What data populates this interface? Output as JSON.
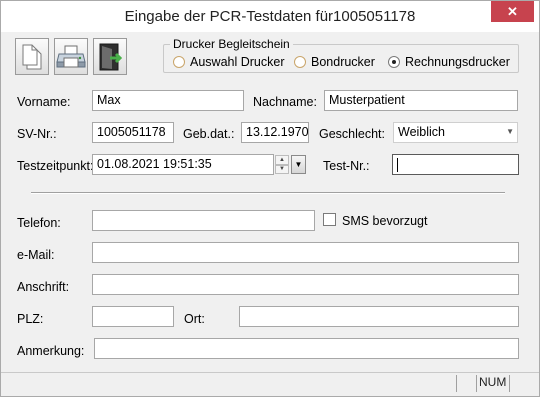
{
  "window": {
    "title": "Eingabe der PCR-Testdaten für1005051178",
    "close_glyph": "✕"
  },
  "toolbar": {
    "items": [
      {
        "icon": "new-document-icon"
      },
      {
        "icon": "printer-icon"
      },
      {
        "icon": "exit-door-icon"
      }
    ]
  },
  "printer_group": {
    "legend": "Drucker Begleitschein",
    "options": [
      "Auswahl Drucker",
      "Bondrucker",
      "Rechnungsdrucker"
    ],
    "selected": "Rechnungsdrucker"
  },
  "form": {
    "vorname": {
      "label": "Vorname:",
      "value": "Max"
    },
    "nachname": {
      "label": "Nachname:",
      "value": "Musterpatient"
    },
    "sv_nr": {
      "label": "SV-Nr.:",
      "value": "1005051178"
    },
    "geb_dat": {
      "label": "Geb.dat.:",
      "value": "13.12.1970"
    },
    "geschlecht": {
      "label": "Geschlecht:",
      "value": "Weiblich"
    },
    "testzeitpunkt": {
      "label": "Testzeitpunkt:",
      "value": "01.08.2021 19:51:35"
    },
    "test_nr": {
      "label": "Test-Nr.:",
      "value": ""
    },
    "telefon": {
      "label": "Telefon:",
      "value": ""
    },
    "sms": {
      "label": "SMS bevorzugt",
      "checked": false
    },
    "email": {
      "label": "e-Mail:",
      "value": ""
    },
    "anschrift": {
      "label": "Anschrift:",
      "value": ""
    },
    "plz": {
      "label": "PLZ:",
      "value": ""
    },
    "ort": {
      "label": "Ort:",
      "value": ""
    },
    "anmerkung": {
      "label": "Anmerkung:",
      "value": ""
    }
  },
  "statusbar": {
    "num_indicator": "NUM"
  }
}
